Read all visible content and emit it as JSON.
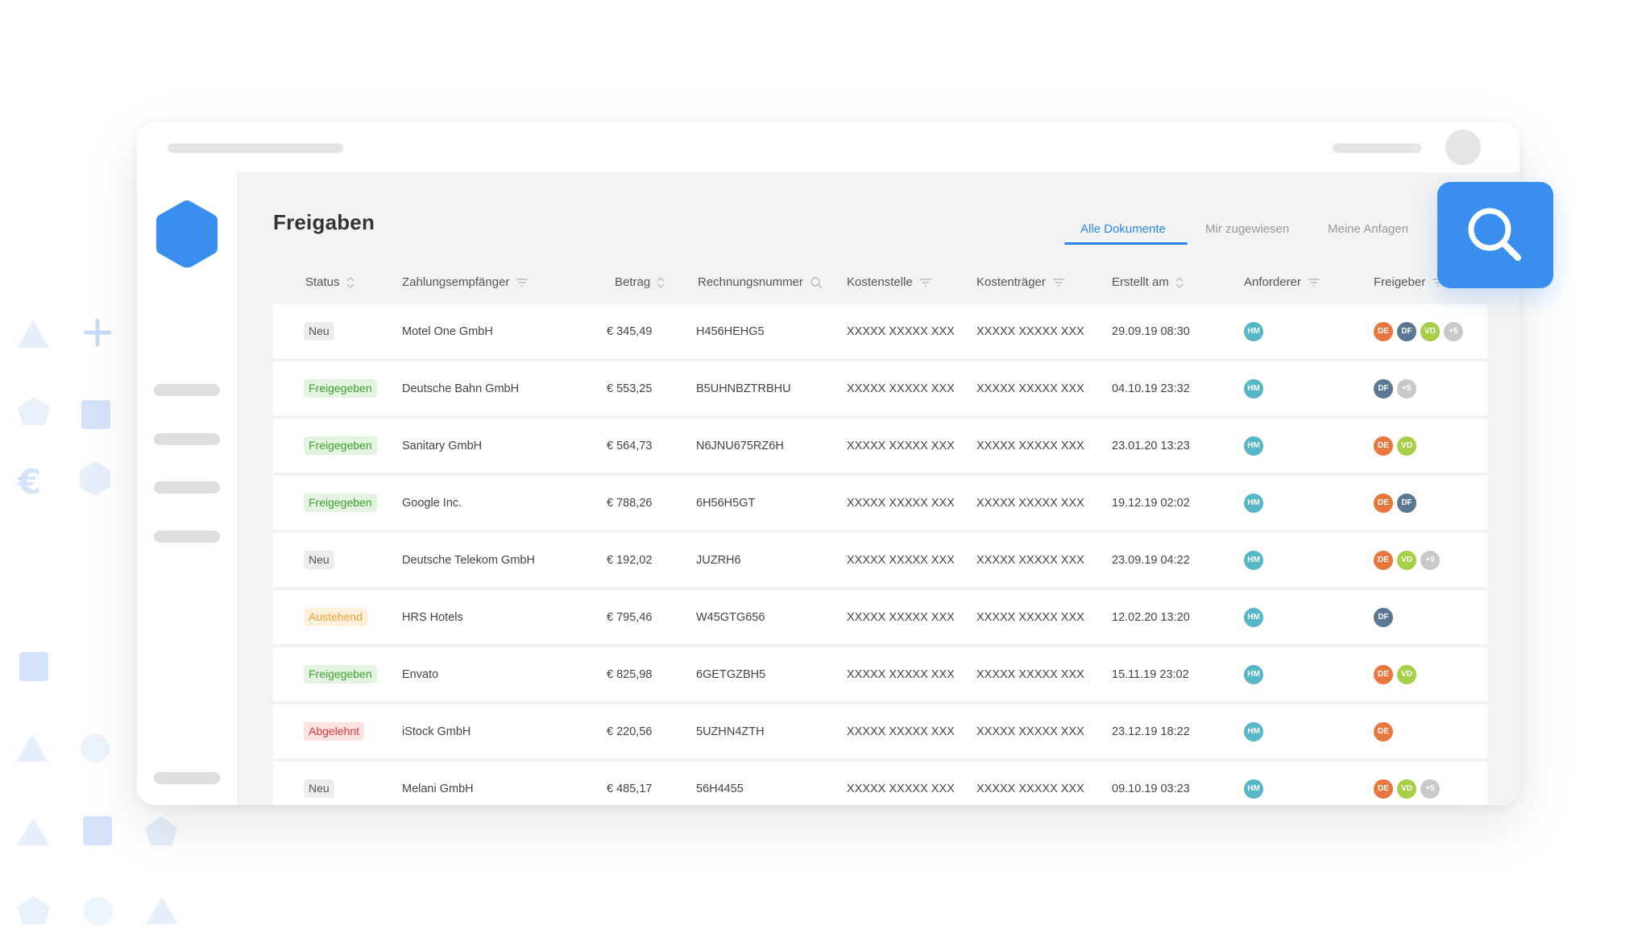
{
  "page": {
    "title": "Freigaben"
  },
  "tabs": [
    {
      "label": "Alle Dokumente",
      "active": true
    },
    {
      "label": "Mir zugewiesen",
      "active": false
    },
    {
      "label": "Meine Anfagen",
      "active": false
    }
  ],
  "columns": [
    {
      "label": "Status",
      "icon": "sort-icon"
    },
    {
      "label": "Zahlungsempfänger",
      "icon": "filter-icon"
    },
    {
      "label": "Betrag",
      "icon": "sort-icon"
    },
    {
      "label": "Rechnungsnummer",
      "icon": "search-icon"
    },
    {
      "label": "Kostenstelle",
      "icon": "filter-icon"
    },
    {
      "label": "Kostenträger",
      "icon": "filter-icon"
    },
    {
      "label": "Erstellt am",
      "icon": "sort-icon"
    },
    {
      "label": "Anforderer",
      "icon": "filter-icon"
    },
    {
      "label": "Freigeber",
      "icon": "filter-icon"
    }
  ],
  "rows": [
    {
      "status": "Neu",
      "status_type": "neu",
      "payee": "Motel One GmbH",
      "amount": "€ 345,49",
      "invoice": "H456HEHG5",
      "cost_center": "XXXXX XXXXX XXX",
      "cost_unit": "XXXXX XXXXX XXX",
      "created": "29.09.19 08:30",
      "requester": "HM",
      "approvers": [
        "DE",
        "DF",
        "VD",
        "+5"
      ]
    },
    {
      "status": "Freigegeben",
      "status_type": "freigegeben",
      "payee": "Deutsche Bahn GmbH",
      "amount": "€ 553,25",
      "invoice": "B5UHNBZTRBHU",
      "cost_center": "XXXXX XXXXX XXX",
      "cost_unit": "XXXXX XXXXX XXX",
      "created": "04.10.19 23:32",
      "requester": "HM",
      "approvers": [
        "DF",
        "+5"
      ]
    },
    {
      "status": "Freigegeben",
      "status_type": "freigegeben",
      "payee": "Sanitary GmbH",
      "amount": "€ 564,73",
      "invoice": "N6JNU675RZ6H",
      "cost_center": "XXXXX XXXXX XXX",
      "cost_unit": "XXXXX XXXXX XXX",
      "created": "23.01.20 13:23",
      "requester": "HM",
      "approvers": [
        "DE",
        "VD"
      ]
    },
    {
      "status": "Freigegeben",
      "status_type": "freigegeben",
      "payee": "Google Inc.",
      "amount": "€ 788,26",
      "invoice": "6H56H5GT",
      "cost_center": "XXXXX XXXXX XXX",
      "cost_unit": "XXXXX XXXXX XXX",
      "created": "19.12.19 02:02",
      "requester": "HM",
      "approvers": [
        "DE",
        "DF"
      ]
    },
    {
      "status": "Neu",
      "status_type": "neu",
      "payee": "Deutsche Telekom GmbH",
      "amount": "€ 192,02",
      "invoice": "JUZRH6",
      "cost_center": "XXXXX XXXXX XXX",
      "cost_unit": "XXXXX XXXXX XXX",
      "created": "23.09.19 04:22",
      "requester": "HM",
      "approvers": [
        "DE",
        "VD",
        "+5"
      ]
    },
    {
      "status": "Austehend",
      "status_type": "austehend",
      "payee": "HRS Hotels",
      "amount": "€ 795,46",
      "invoice": "W45GTG656",
      "cost_center": "XXXXX XXXXX XXX",
      "cost_unit": "XXXXX XXXXX XXX",
      "created": "12.02.20 13:20",
      "requester": "HM",
      "approvers": [
        "DF"
      ]
    },
    {
      "status": "Freigegeben",
      "status_type": "freigegeben",
      "payee": "Envato",
      "amount": "€ 825,98",
      "invoice": "6GETGZBH5",
      "cost_center": "XXXXX XXXXX XXX",
      "cost_unit": "XXXXX XXXXX XXX",
      "created": "15.11.19 23:02",
      "requester": "HM",
      "approvers": [
        "DE",
        "VD"
      ]
    },
    {
      "status": "Abgelehnt",
      "status_type": "abgelehnt",
      "payee": "iStock GmbH",
      "amount": "€ 220,56",
      "invoice": "5UZHN4ZTH",
      "cost_center": "XXXXX XXXXX XXX",
      "cost_unit": "XXXXX XXXXX XXX",
      "created": "23.12.19 18:22",
      "requester": "HM",
      "approvers": [
        "DE"
      ]
    },
    {
      "status": "Neu",
      "status_type": "neu",
      "payee": "Melani GmbH",
      "amount": "€ 485,17",
      "invoice": "56H4455",
      "cost_center": "XXXXX XXXXX XXX",
      "cost_unit": "XXXXX XXXXX XXX",
      "created": "09.10.19 03:23",
      "requester": "HM",
      "approvers": [
        "DE",
        "VD",
        "+5"
      ]
    }
  ],
  "colors": {
    "accent": "#2b86ee",
    "logo": "#3a8fee",
    "status_neu": "#555555",
    "status_freigegeben": "#3da12e",
    "status_austehend": "#f0a030",
    "status_abgelehnt": "#e03a3a",
    "avatar_hm": "#56b8c6",
    "avatar_de": "#e8773d",
    "avatar_df": "#5c7794",
    "avatar_vd": "#a7cf47",
    "avatar_more": "#c9c9c9"
  },
  "icons": {
    "logo": "hexagon-logo-icon",
    "search_button": "magnifier-icon"
  }
}
